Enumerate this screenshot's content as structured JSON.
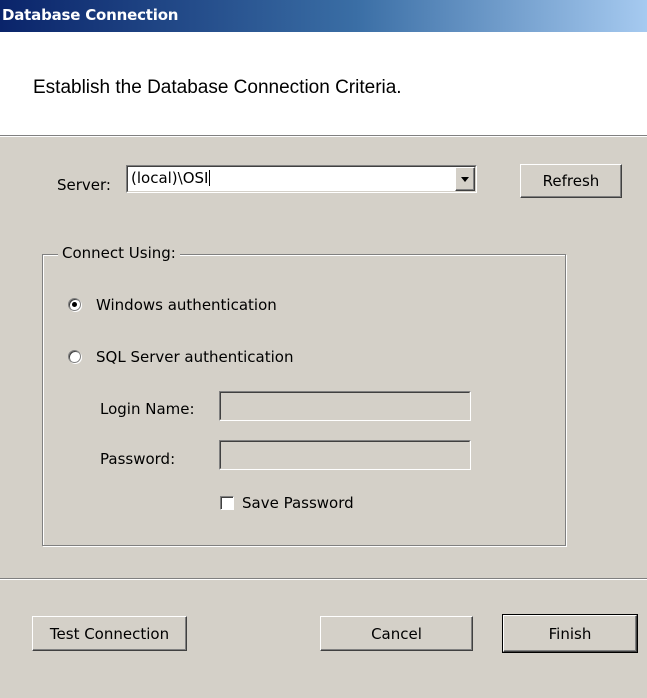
{
  "window": {
    "title": "Database Connection"
  },
  "header": {
    "instruction": "Establish the Database Connection Criteria."
  },
  "server": {
    "label": "Server:",
    "value": "(local)\\OSI",
    "refresh_label": "Refresh"
  },
  "connect_using": {
    "legend": "Connect Using:",
    "windows_auth_label": "Windows authentication",
    "windows_auth_selected": true,
    "sql_auth_label": "SQL Server authentication",
    "sql_auth_selected": false,
    "login_name_label": "Login Name:",
    "login_name_value": "",
    "password_label": "Password:",
    "password_value": "",
    "save_password_label": "Save Password",
    "save_password_checked": false
  },
  "footer": {
    "test_connection_label": "Test Connection",
    "cancel_label": "Cancel",
    "finish_label": "Finish"
  },
  "colors": {
    "dialog_face": "#d4d0c8",
    "title_bar_start": "#0a246a",
    "title_bar_end": "#a6caf0"
  }
}
